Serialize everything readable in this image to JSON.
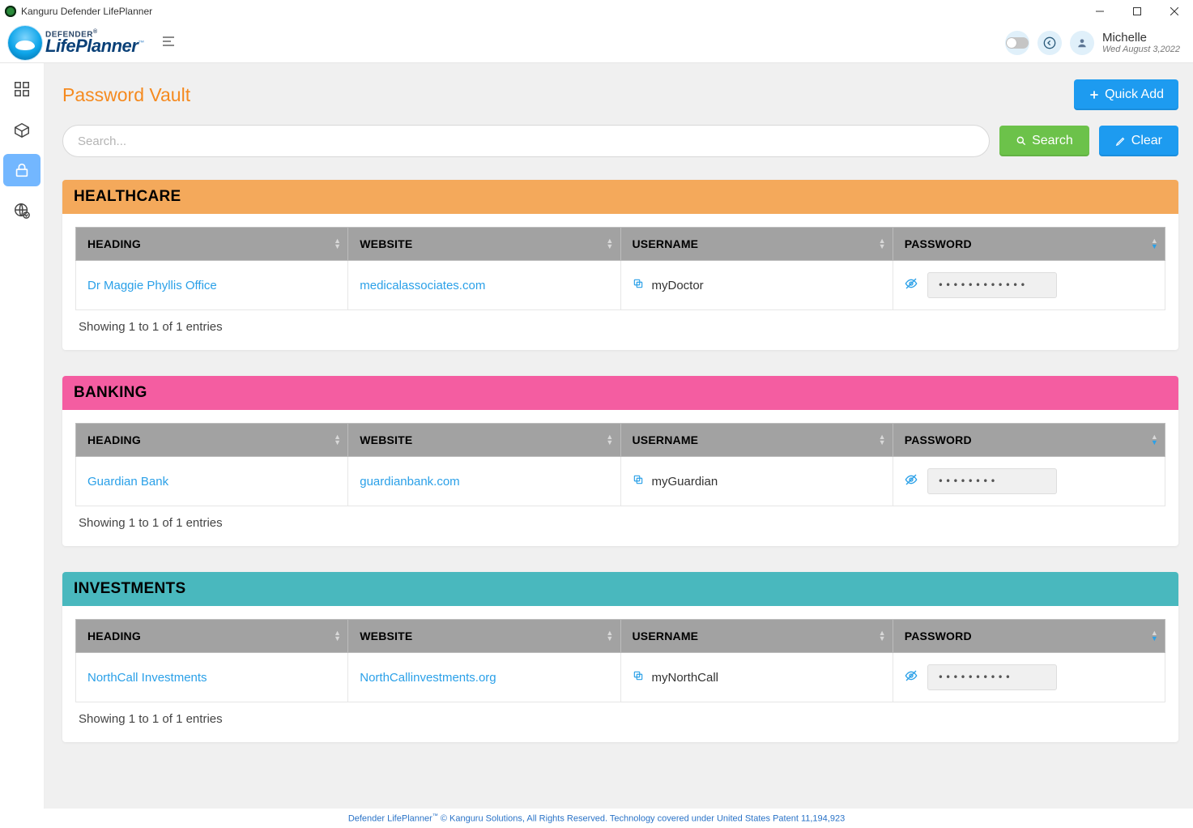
{
  "window": {
    "title": "Kanguru Defender LifePlanner"
  },
  "logo": {
    "line1": "DEFENDER",
    "line1_sup": "®",
    "line2": "LifePlanner",
    "line2_sup": "™"
  },
  "user": {
    "name": "Michelle",
    "date": "Wed August 3,2022"
  },
  "page": {
    "title": "Password Vault",
    "quick_add_label": "Quick Add",
    "search_placeholder": "Search...",
    "search_label": "Search",
    "clear_label": "Clear"
  },
  "columns": {
    "heading": "HEADING",
    "website": "WEBSITE",
    "username": "USERNAME",
    "password": "PASSWORD"
  },
  "categories": [
    {
      "name": "HEALTHCARE",
      "color": "#f4a95b",
      "rows": [
        {
          "heading": "Dr Maggie Phyllis Office",
          "website": "medicalassociates.com",
          "username": "myDoctor",
          "password_mask": "••••••••••••"
        }
      ],
      "info": "Showing 1 to 1 of 1 entries"
    },
    {
      "name": "BANKING",
      "color": "#f45da1",
      "rows": [
        {
          "heading": "Guardian Bank",
          "website": "guardianbank.com",
          "username": "myGuardian",
          "password_mask": "••••••••"
        }
      ],
      "info": "Showing 1 to 1 of 1 entries"
    },
    {
      "name": "INVESTMENTS",
      "color": "#49b8be",
      "rows": [
        {
          "heading": "NorthCall Investments",
          "website": "NorthCallinvestments.org",
          "username": "myNorthCall",
          "password_mask": "••••••••••"
        }
      ],
      "info": "Showing 1 to 1 of 1 entries"
    }
  ],
  "footer": {
    "product": "Defender LifePlanner",
    "tm": "™",
    "rest": " © Kanguru Solutions, All Rights Reserved. Technology covered under United States Patent 11,194,923"
  }
}
